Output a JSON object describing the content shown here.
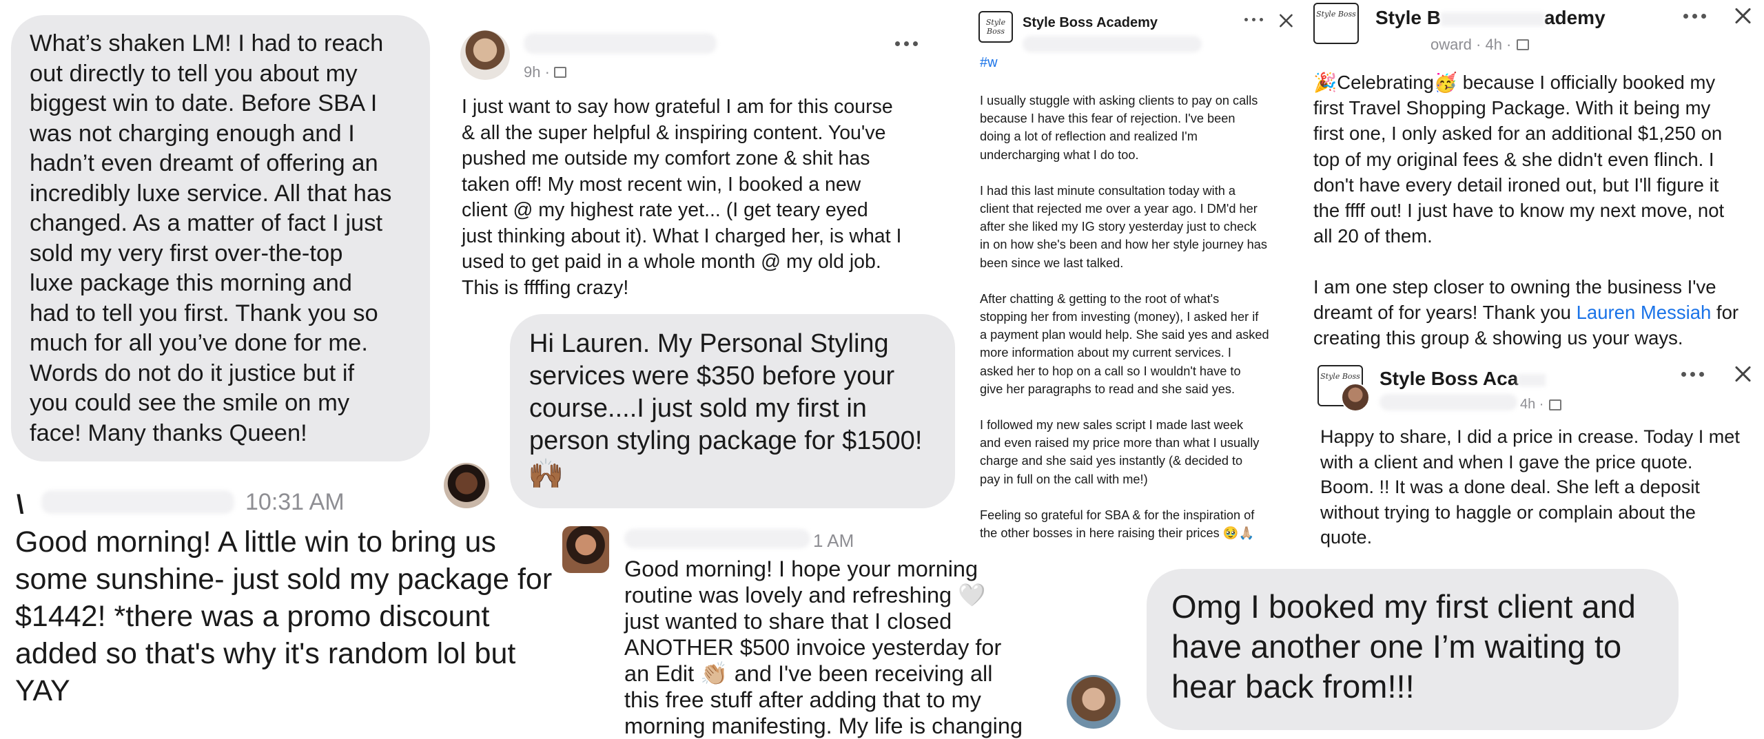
{
  "post1": {
    "message": "What’s shaken LM! I had to reach\nout directly to tell you about my\nbiggest win to date. Before SBA I\nwas not charging enough and I\nhadn’t even dreamt of offering an\nincredibly luxe service. All that has\nchanged. As a matter of fact I just\nsold my very first over-the-top\nluxe package this morning and\nhad to tell you first. Thank you so\nmuch for all you’ve done for me.\nWords do not do it justice but if\nyou could see the smile on my\nface!  Many thanks Queen!"
  },
  "post2": {
    "time": "9h ·",
    "message": "I just want to say how grateful I am for this course\n& all the super helpful & inspiring content.  You've\npushed me outside my comfort zone & shit has\ntaken off!  My most recent win, I booked a new\nclient @ my highest rate yet...  (I get teary eyed\njust thinking about it).  What I charged her, is what I\nused to get paid in a whole month @ my old job.\nThis is ffffing crazy!"
  },
  "post3": {
    "message": "Hi Lauren. My Personal Styling\nservices were $350 before your\ncourse....I just sold my first in\nperson styling package for $1500!",
    "emoji": "🙌🏾"
  },
  "post4": {
    "time": "10:31 AM",
    "message": "Good morning! A little win to bring us\nsome sunshine- just sold my package for\n$1442! *there was a promo discount\nadded so that's why it's random lol but\nYAY"
  },
  "post5": {
    "time": "1 AM",
    "message": "Good morning! I hope your morning\nroutine was lovely and refreshing 🤍\njust wanted to share that I closed\nANOTHER $500 invoice yesterday for\nan Edit 👏🏼 and I've been receiving all\nthis free stuff after adding that to my\nmorning manifesting. My life is changing"
  },
  "post6": {
    "group": "Style Boss Academy",
    "hashtag": "#w",
    "logo": "Style Boss",
    "paragraphs": [
      "I usually stuggle with asking clients to pay on calls\nbecause I have this fear of rejection. I've been\ndoing a lot of reflection and realized I'm\nundercharging what I do too.",
      "I had this last minute consultation today with a\nclient that rejected me over a year ago. I DM'd her\nafter she liked my IG story yesterday just to check\nin on how she's been and how her style journey has\nbeen since we last talked.",
      "After chatting & getting to the root of what's\nstopping her from investing (money), I asked her if\na payment plan would help. She said yes and asked\nmore information about my current services. I\nasked her to hop on a call so I wouldn't have to\ngive her paragraphs to read and she said yes.",
      "I followed my new sales script I made last week\nand even raised my price more than what I usually\ncharge and she said yes instantly (& decided to\npay in full on the call with me!)",
      "Feeling so grateful for SBA & for the inspiration of\nthe other bosses in here raising their prices 🥹🙏🏼"
    ]
  },
  "post7": {
    "group": "Style B",
    "group_tail": "ademy",
    "meta": "oward · 4h ·",
    "logo": "Style Boss",
    "message_a": "🎉Celebrating🥳 because I officially booked my\nfirst Travel Shopping Package.  With it being my\nfirst one, I only asked for an additional $1,250 on\ntop of my original fees & she didn't even flinch.  I\ndon't have every detail ironed out, but I'll figure it\nthe ffff out!  I just have to know my next move, not\nall 20 of them.",
    "message_b_pre": "I am one step closer to owning the business I've\ndreamt of for years!  Thank you ",
    "mention": "Lauren Messiah",
    "message_b_post": " for\ncreating this group & showing us your ways."
  },
  "post8": {
    "group": "Style Boss Aca",
    "meta": "4h ·",
    "logo": "Style Boss",
    "message": "Happy to share, I did a price in crease. Today I met\nwith a client and when I gave the price quote.\nBoom. !! It was a done deal. She left a deposit\nwithout trying to haggle or complain about the\nquote."
  },
  "post9": {
    "message": "Omg I booked my first client and\nhave another one I’m waiting to\nhear back from!!!"
  },
  "colors": {
    "bubble": "#e9e9eb",
    "link": "#1a73e8",
    "text": "#1a1a1a",
    "muted": "#8e8e93"
  }
}
